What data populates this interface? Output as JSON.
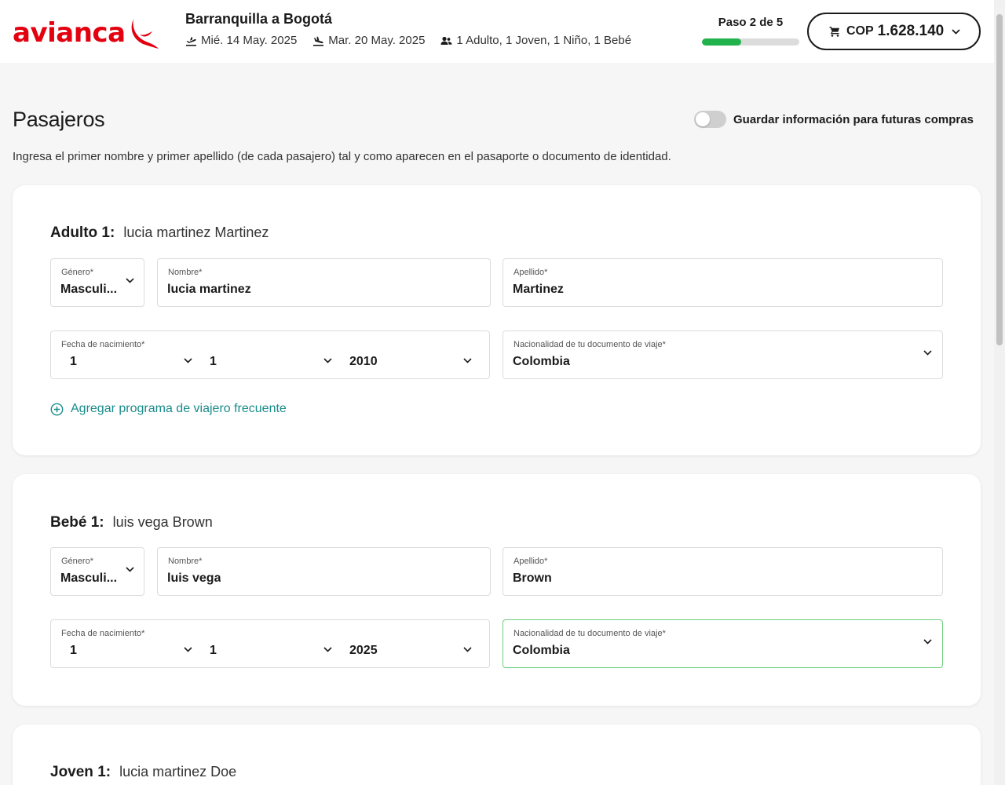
{
  "header": {
    "logo_text": "avianca",
    "route_title": "Barranquilla a Bogotá",
    "departure_date": "Mié. 14 May. 2025",
    "return_date": "Mar. 20 May. 2025",
    "passengers_summary": "1 Adulto, 1 Joven, 1 Niño, 1 Bebé",
    "step_label": "Paso 2 de 5",
    "step_progress_fraction": 0.4,
    "cart_currency": "COP",
    "cart_amount": "1.628.140"
  },
  "page": {
    "title": "Pasajeros",
    "save_toggle_label": "Guardar información para futuras compras",
    "save_toggle_on": false,
    "instructions": "Ingresa el primer nombre y primer apellido (de cada pasajero) tal y como aparecen en el pasaporte o documento de identidad."
  },
  "labels": {
    "gender": "Género*",
    "first_name": "Nombre*",
    "last_name": "Apellido*",
    "birth_date": "Fecha de nacimiento*",
    "nationality": "Nacionalidad de tu documento de viaje*",
    "frequent_flyer_link": "Agregar programa de viajero frecuente"
  },
  "passengers": [
    {
      "type_label": "Adulto 1:",
      "full_name": "lucia martinez Martinez",
      "gender": "Masculi...",
      "first_name": "lucia martinez",
      "last_name": "Martinez",
      "birth_day": "1",
      "birth_month": "1",
      "birth_year": "2010",
      "nationality": "Colombia"
    },
    {
      "type_label": "Bebé 1:",
      "full_name": "luis vega Brown",
      "gender": "Masculi...",
      "first_name": "luis vega",
      "last_name": "Brown",
      "birth_day": "1",
      "birth_month": "1",
      "birth_year": "2025",
      "nationality": "Colombia"
    },
    {
      "type_label": "Joven 1:",
      "full_name": "lucia martinez Doe"
    }
  ],
  "colors": {
    "brand_red": "#e3000f",
    "progress_green": "#22b24c",
    "link_teal": "#1a8b8b",
    "focus_green": "#6fcf7f"
  }
}
